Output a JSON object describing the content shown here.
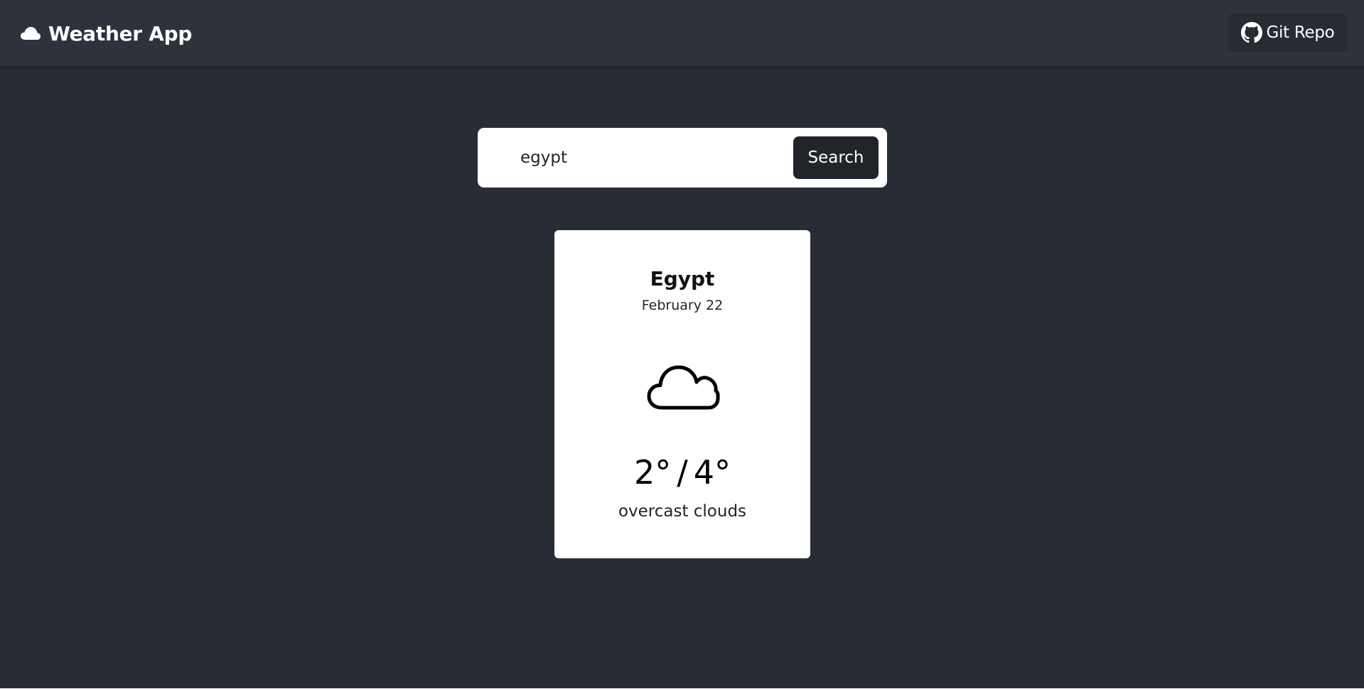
{
  "navbar": {
    "brand_icon": "cloud-icon",
    "brand_title": "Weather App",
    "repo_icon": "github-icon",
    "repo_label": "Git Repo"
  },
  "search": {
    "value": "egypt",
    "button_label": "Search"
  },
  "weather": {
    "city": "Egypt",
    "date": "February 22",
    "icon": "cloud-outline-icon",
    "temp_min": "2°",
    "separator": "/",
    "temp_max": "4°",
    "description": "overcast clouds"
  },
  "colors": {
    "background": "#282c34",
    "navbar": "#2e323a",
    "button_dark": "#212529",
    "card": "#ffffff"
  }
}
